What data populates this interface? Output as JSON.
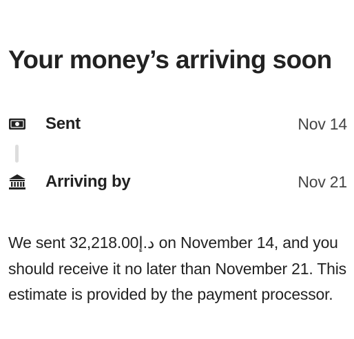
{
  "header": {
    "title": "Your money’s arriving soon"
  },
  "timeline": {
    "sent": {
      "icon": "money-icon",
      "label": "Sent",
      "date": "Nov 14"
    },
    "arriving": {
      "icon": "bank-icon",
      "label": "Arriving by",
      "date": "Nov 21"
    }
  },
  "description": {
    "text": "We sent 32,218.00د.إ on November 14, and you should receive it no later than November 21. This estimate is provided by the payment processor."
  },
  "colors": {
    "text": "#222222",
    "muted_text": "#444444",
    "connector": "#dddddd"
  }
}
